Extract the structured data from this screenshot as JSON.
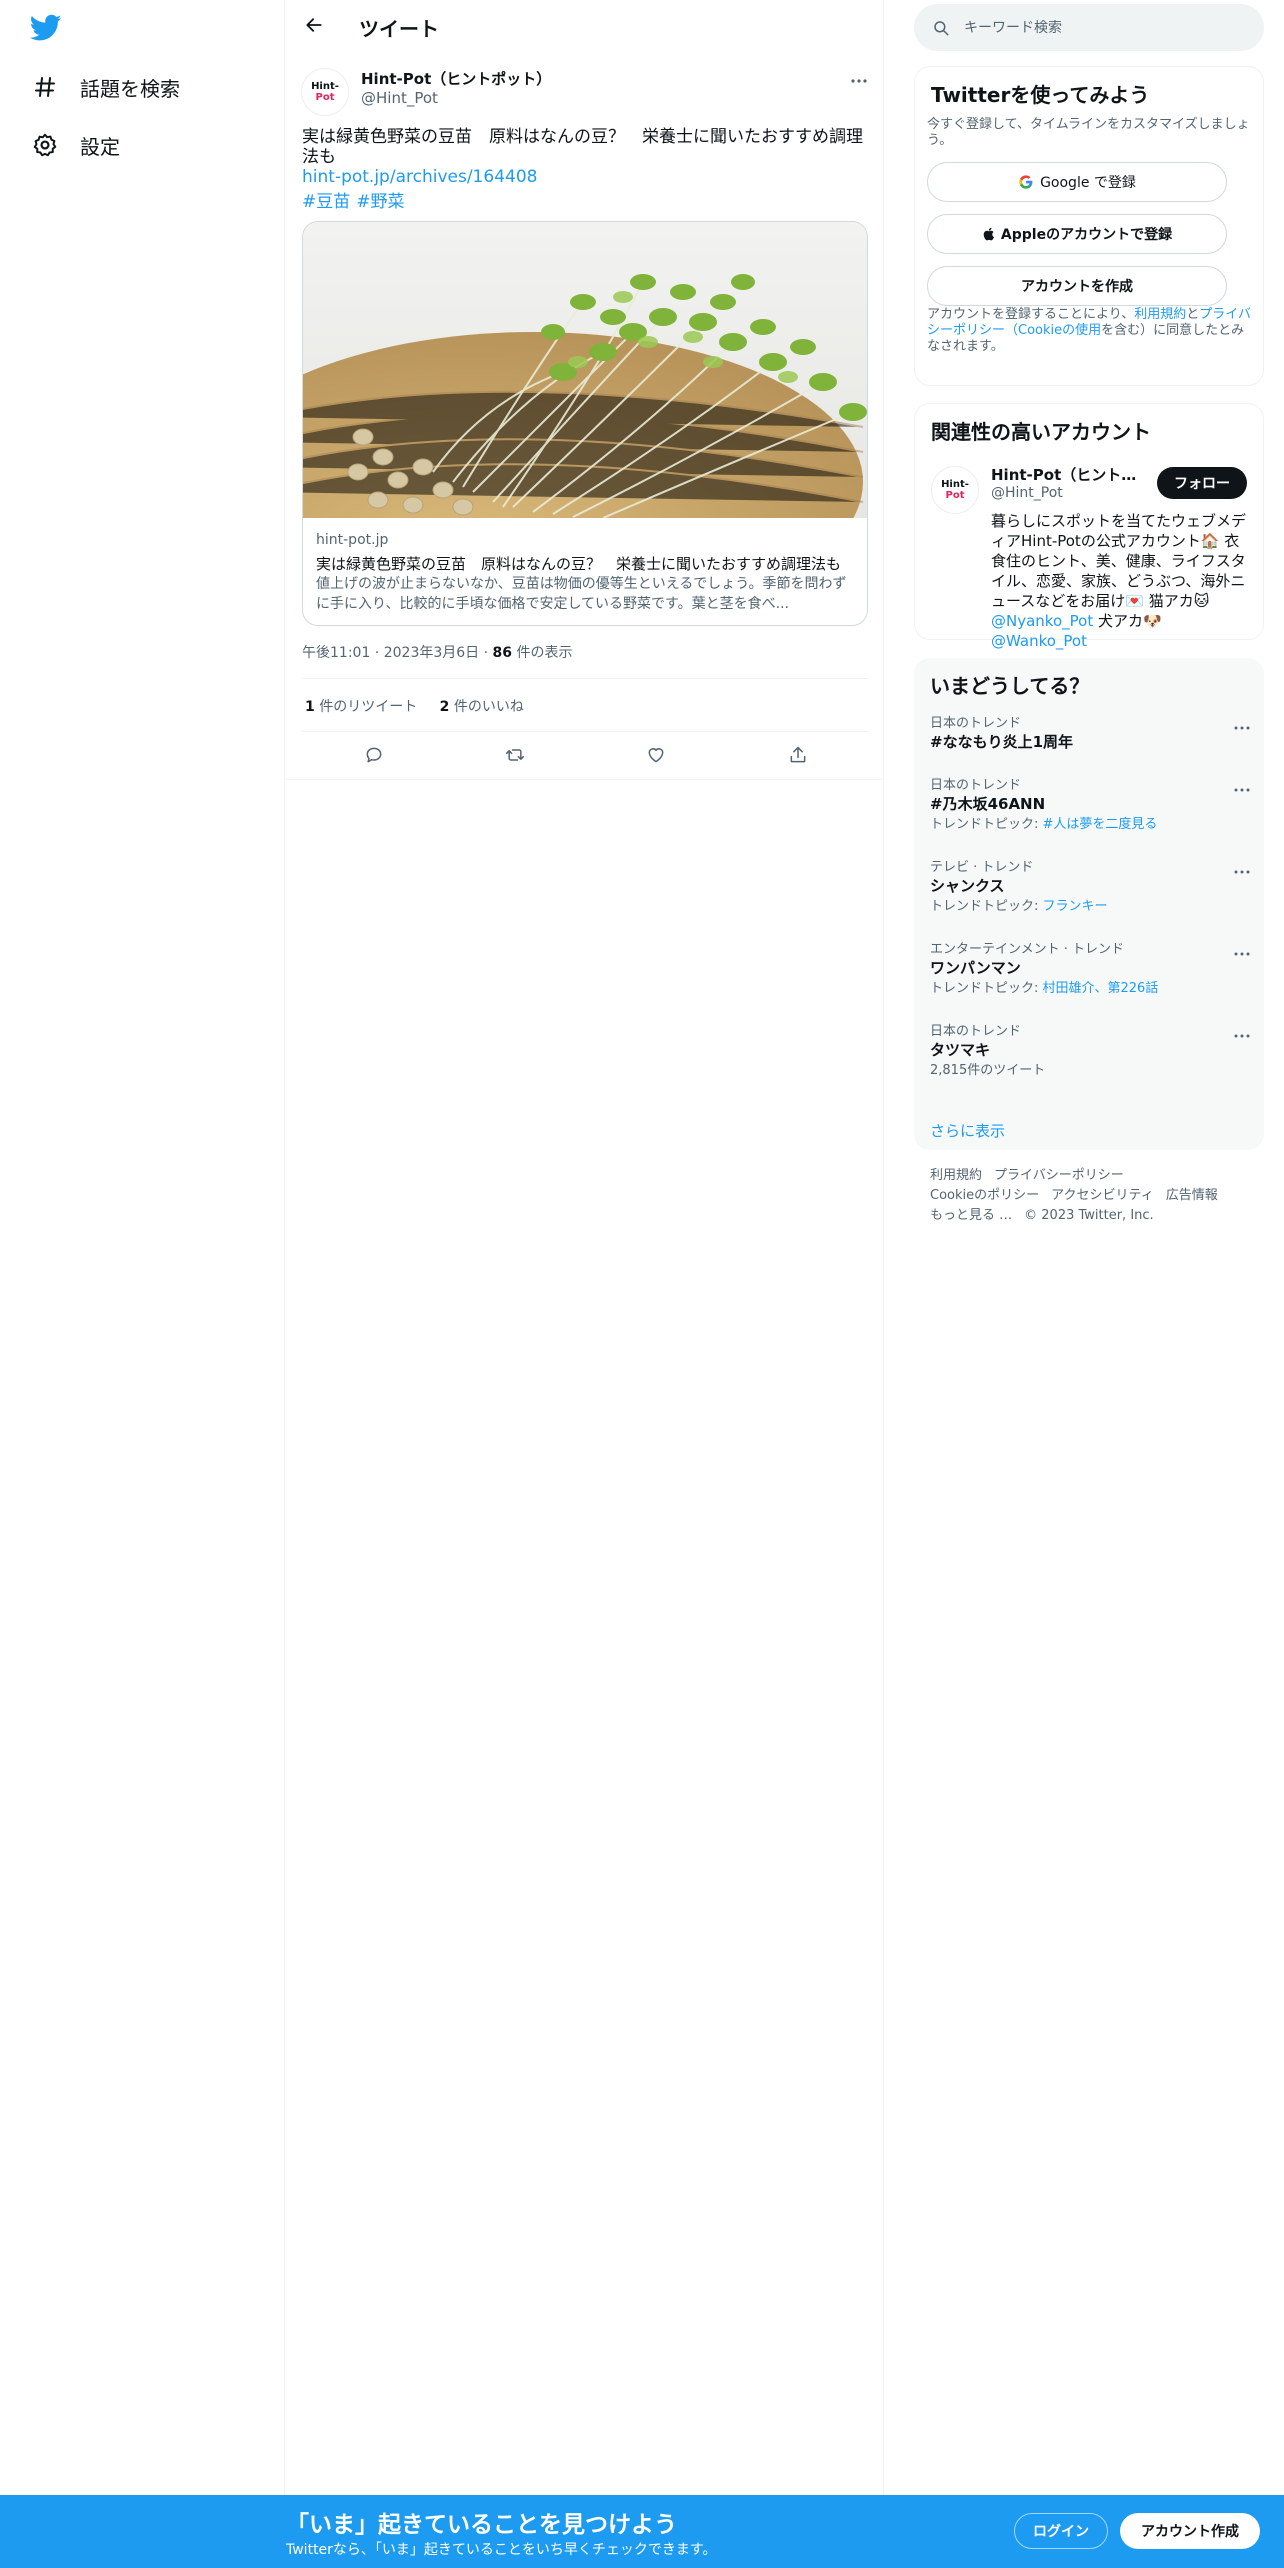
{
  "colors": {
    "accent": "#1d9bf0",
    "text": "#0f1419",
    "muted": "#536471"
  },
  "nav": {
    "logo_icon": "twitter-bird-icon",
    "items": [
      {
        "label": "話題を検索",
        "icon": "hashtag-icon"
      },
      {
        "label": "設定",
        "icon": "gear-icon"
      }
    ]
  },
  "header": {
    "title": "ツイート",
    "back_icon": "back-arrow-icon"
  },
  "tweet": {
    "author_name": "Hint-Pot（ヒントポット）",
    "author_handle": "@Hint_Pot",
    "avatar_text_1": "Hint-",
    "avatar_text_2": "Pot",
    "text": "実は緑黄色野菜の豆苗　原料はなんの豆？　栄養士に聞いたおすすめ調理法も",
    "link": "hint-pot.jp/archives/164408",
    "hashtags": [
      "#豆苗",
      "#野菜"
    ],
    "card": {
      "domain": "hint-pot.jp",
      "title": "実は緑黄色野菜の豆苗　原料はなんの豆？　栄養士に聞いたおすすめ調理法も",
      "description": "値上げの波が止まらないなか、豆苗は物価の優等生といえるでしょう。季節を問わずに手に入り、比較的に手頃な価格で安定している野菜です。葉と茎を食べ..."
    },
    "time": "午後11:01",
    "date": "2023年3月6日",
    "views_count": "86",
    "views_label": "件の表示",
    "retweets_count": "1",
    "retweets_label": "件のリツイート",
    "likes_count": "2",
    "likes_label": "件のいいね"
  },
  "search": {
    "placeholder": "キーワード検索"
  },
  "signup": {
    "title": "Twitterを使ってみよう",
    "subtitle": "今すぐ登録して、タイムラインをカスタマイズしましょう。",
    "google_label": "Google で登録",
    "apple_label": "Appleのアカウントで登録",
    "create_label": "アカウントを作成",
    "legal_1": "アカウントを登録することにより、",
    "legal_terms": "利用規約",
    "legal_and": "と",
    "legal_privacy": "プライバシーポリシー（Cookieの使用",
    "legal_2": "を含む）に同意したとみなされます。"
  },
  "related": {
    "title": "関連性の高いアカウント",
    "name": "Hint-Pot（ヒントポット）",
    "handle": "@Hint_Pot",
    "follow_label": "フォロー",
    "bio": "暮らしにスポットを当てたウェブメディアHint-Potの公式アカウント🏠 衣食住のヒント、美、健康、ライフスタイル、恋愛、家族、どうぶつ、海外ニュースなどをお届け💌 猫アカ🐱",
    "bio_link_1": "@Nyanko_Pot",
    "bio_mid": " 犬アカ🐶",
    "bio_link_2": "@Wanko_Pot"
  },
  "trends": {
    "title": "いまどうしてる？",
    "items": [
      {
        "category": "日本のトレンド",
        "name": "#ななもり炎上1周年",
        "extra_label": "",
        "extra_link": ""
      },
      {
        "category": "日本のトレンド",
        "name": "#乃木坂46ANN",
        "extra_label": "トレンドトピック: ",
        "extra_link": "#人は夢を二度見る"
      },
      {
        "category": "テレビ · トレンド",
        "name": "シャンクス",
        "extra_label": "トレンドトピック: ",
        "extra_link": "フランキー"
      },
      {
        "category": "エンターテインメント · トレンド",
        "name": "ワンパンマン",
        "extra_label": "トレンドトピック: ",
        "extra_link": "村田雄介、第226話"
      },
      {
        "category": "日本のトレンド",
        "name": "タツマキ",
        "extra_label": "2,815件のツイート",
        "extra_link": ""
      }
    ],
    "show_more": "さらに表示"
  },
  "footer": {
    "links": [
      "利用規約",
      "プライバシーポリシー",
      "Cookieのポリシー",
      "アクセシビリティ",
      "広告情報",
      "もっと見る …"
    ],
    "copyright": "© 2023 Twitter, Inc."
  },
  "banner": {
    "title": "「いま」起きていることを見つけよう",
    "subtitle": "Twitterなら、「いま」起きていることをいち早くチェックできます。",
    "login_label": "ログイン",
    "signup_label": "アカウント作成"
  }
}
